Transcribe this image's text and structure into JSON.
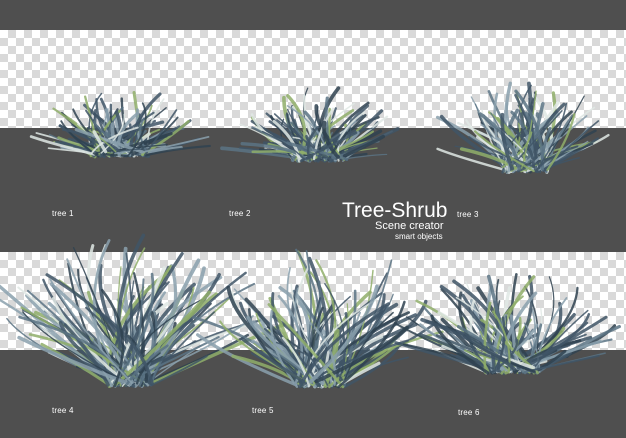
{
  "title": "Tree-Shrub",
  "subtitle": "Scene creator",
  "tagline": "smart objects",
  "labels": [
    "tree 1",
    "tree 2",
    "tree 3",
    "tree 4",
    "tree 5",
    "tree 6"
  ],
  "colors": {
    "background": "#4f4f4f",
    "checker_light": "#ffffff",
    "checker_dark": "#d9d9d9",
    "leaf_dark": "#3f5566",
    "leaf_light": "#dfe7e4",
    "leaf_green": "#8fae6a"
  }
}
